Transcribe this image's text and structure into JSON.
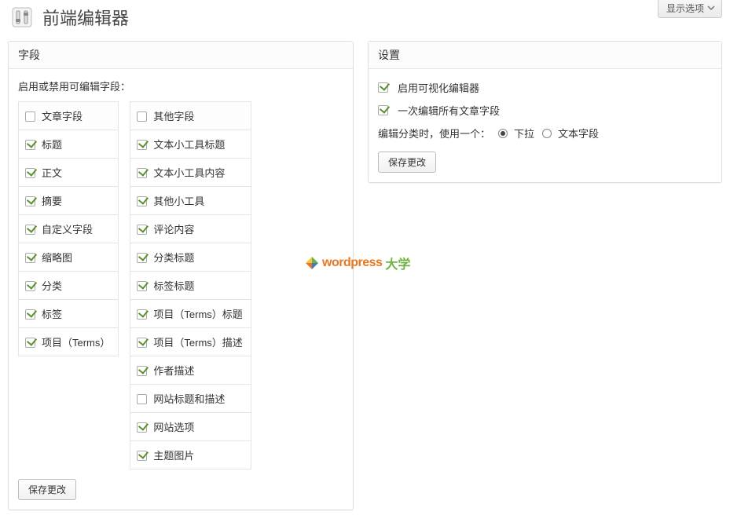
{
  "screen_options_label": "显示选项",
  "page_title": "前端编辑器",
  "fields_panel": {
    "title": "字段",
    "note": "启用或禁用可编辑字段：",
    "post_header": "文章字段",
    "other_header": "其他字段",
    "post_fields": {
      "title": "标题",
      "body": "正文",
      "excerpt": "摘要",
      "custom_fields": "自定义字段",
      "thumbnail": "缩略图",
      "category": "分类",
      "tag": "标签",
      "terms": "项目（Terms）"
    },
    "other_fields": {
      "text_widget_title": "文本小工具标题",
      "text_widget_content": "文本小工具内容",
      "other_widgets": "其他小工具",
      "comment_content": "评论内容",
      "category_title": "分类标题",
      "tag_title": "标签标题",
      "terms_title": "项目（Terms）标题",
      "terms_desc": "项目（Terms）描述",
      "author_desc": "作者描述",
      "site_title_desc": "网站标题和描述",
      "site_options": "网站选项",
      "theme_images": "主题图片"
    },
    "save_label": "保存更改"
  },
  "settings_panel": {
    "title": "设置",
    "enable_visual_editor": "启用可视化编辑器",
    "edit_all_fields_once": "一次编辑所有文章字段",
    "edit_tax_prompt": "编辑分类时，使用一个：",
    "option_dropdown": "下拉",
    "option_textfield": "文本字段",
    "save_label": "保存更改"
  },
  "watermark": {
    "word": "wordpress",
    "cn": "大学"
  }
}
